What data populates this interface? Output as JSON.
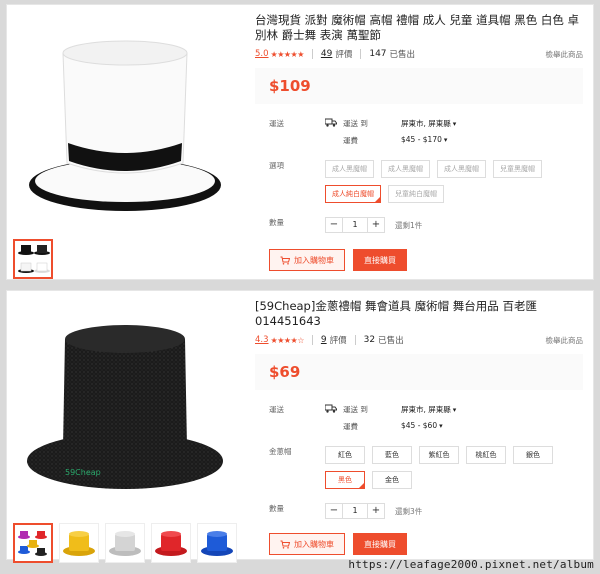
{
  "products": [
    {
      "title": "台灣現貨 派對 魔術帽 高帽 禮帽 成人 兒童 道具帽 黑色 白色 卓別林 爵士舞 表演 萬聖節",
      "rating": "5.0",
      "stars": "★★★★★",
      "reviews_count": "49",
      "reviews_label": "評價",
      "sold_count": "147",
      "sold_label": "已售出",
      "report_label": "檢舉此商品",
      "price": "$109",
      "shipping_label": "運送",
      "ship_to_label": "運送 到",
      "ship_to_value": "屏東市, 屏東縣",
      "ship_fee_label": "運費",
      "ship_fee_value": "$45 - $170",
      "variant_label": "選項",
      "variants": [
        {
          "label": "成人黑魔帽",
          "state": "disabled"
        },
        {
          "label": "成人黑魔帽",
          "state": "disabled"
        },
        {
          "label": "成人黑魔帽",
          "state": "disabled"
        },
        {
          "label": "兒童黑魔帽",
          "state": "disabled"
        },
        {
          "label": "成人純白魔帽",
          "state": "selected"
        },
        {
          "label": "兒童純白魔帽",
          "state": "disabled"
        }
      ],
      "qty_label": "數量",
      "qty_value": "1",
      "stock_text": "還剩1件",
      "add_cart_label": "加入購物車",
      "buy_now_label": "直接購買"
    },
    {
      "title": "[59Cheap]金蔥禮帽 舞會道具 魔術帽 舞台用品 百老匯 014451643",
      "rating": "4.3",
      "stars": "★★★★☆",
      "reviews_count": "9",
      "reviews_label": "評價",
      "sold_count": "32",
      "sold_label": "已售出",
      "report_label": "檢舉此商品",
      "price": "$69",
      "shipping_label": "運送",
      "ship_to_label": "運送 到",
      "ship_to_value": "屏東市, 屏東縣",
      "ship_fee_label": "運費",
      "ship_fee_value": "$45 - $60",
      "variant_label": "金蔥帽",
      "variants": [
        {
          "label": "紅色",
          "state": "normal"
        },
        {
          "label": "藍色",
          "state": "normal"
        },
        {
          "label": "紫紅色",
          "state": "normal"
        },
        {
          "label": "桃紅色",
          "state": "normal"
        },
        {
          "label": "銀色",
          "state": "normal"
        },
        {
          "label": "黑色",
          "state": "selected"
        },
        {
          "label": "金色",
          "state": "normal"
        }
      ],
      "qty_label": "數量",
      "qty_value": "1",
      "stock_text": "還剩3件",
      "add_cart_label": "加入購物車",
      "buy_now_label": "直接購買"
    }
  ],
  "qty_minus": "−",
  "qty_plus": "+",
  "chevron": "▾",
  "photo_logo": "59Cheap",
  "watermark": "https://leafage2000.pixnet.net/album",
  "colors": {
    "accent": "#ee4d2d",
    "price_bg": "#fafafa"
  }
}
